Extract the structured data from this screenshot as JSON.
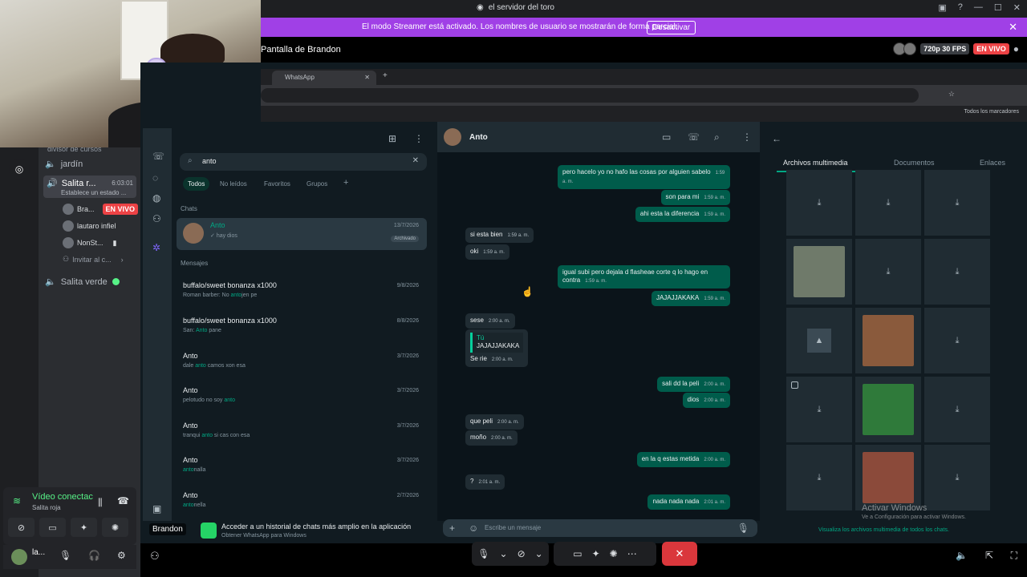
{
  "window": {
    "title": "el servidor del toro"
  },
  "banner": {
    "text": "El modo Streamer está activado. Los nombres de usuario se mostrarán de forma parcial.",
    "button": "Desactivar"
  },
  "stream": {
    "title": "Pantalla de Brandon",
    "quality": "720p 30 FPS",
    "live": "EN VIVO"
  },
  "sidebar": {
    "category": "divisor de cursos",
    "channels": [
      {
        "name": "jardín"
      },
      {
        "name": "Salita r...",
        "time": "6:03:01",
        "status": "Establece un estado ..."
      },
      {
        "name": "Salita verde"
      }
    ],
    "users": [
      {
        "name": "Bra...",
        "badge": "EN VIVO"
      },
      {
        "name": "lautaro infiel"
      },
      {
        "name": "NonSt..."
      }
    ],
    "invite": "Invitar al c...",
    "voice": {
      "status": "Vídeo conectac",
      "sub": "Salita roja"
    },
    "user": {
      "name": "la..."
    }
  },
  "browser": {
    "tab": "WhatsApp",
    "bookmarks": "Todos los marcadores"
  },
  "whatsapp": {
    "search": "anto",
    "filters": [
      "Todos",
      "No leídos",
      "Favoritos",
      "Grupos"
    ],
    "chats_label": "Chats",
    "pinned": {
      "name": "Anto",
      "preview": "hay dios",
      "date": "13/7/2026",
      "tag": "Archivado"
    },
    "messages_label": "Mensajes",
    "rows": [
      {
        "name": "buffalo/sweet bonanza x1000",
        "pre": "Roman barber: No ",
        "hl": "anto",
        "post": "jen pe",
        "date": "9/8/2026"
      },
      {
        "name": "buffalo/sweet bonanza x1000",
        "pre": "San: ",
        "hl": "Anto",
        "post": " pane",
        "date": "8/8/2026"
      },
      {
        "name": "Anto",
        "pre": "dale ",
        "hl": "anto",
        "post": " camos xon esa",
        "date": "3/7/2026"
      },
      {
        "name": "Anto",
        "pre": "pelotudo no soy ",
        "hl": "anto",
        "post": "",
        "date": "3/7/2026"
      },
      {
        "name": "Anto",
        "pre": "tranqui ",
        "hl": "anto",
        "post": " si cas con esa",
        "date": "3/7/2026"
      },
      {
        "name": "Anto",
        "pre": "",
        "hl": "anto",
        "post": "nalla",
        "date": "3/7/2026"
      },
      {
        "name": "Anto",
        "pre": "",
        "hl": "anto",
        "post": "nella",
        "date": "2/7/2026"
      }
    ],
    "banner": {
      "title": "Acceder a un historial de chats más amplio en la aplicación",
      "sub": "Obtener WhatsApp para Windows"
    },
    "conversation": {
      "contact": "Anto",
      "messages": [
        {
          "dir": "out",
          "text": "pero hacelo yo no hafo las cosas por alguien sabelo",
          "time": "1:59 a. m."
        },
        {
          "dir": "out",
          "text": "son para mi",
          "time": "1:59 a. m."
        },
        {
          "dir": "out",
          "text": "ahi esta la diferencia",
          "time": "1:59 a. m."
        },
        {
          "dir": "in",
          "text": "si esta bien",
          "time": "1:59 a. m."
        },
        {
          "dir": "in",
          "text": "oki",
          "time": "1:59 a. m."
        },
        {
          "dir": "out",
          "text": "igual subi pero dejala d flasheae corte q lo hago en contra",
          "time": "1:59 a. m."
        },
        {
          "dir": "out",
          "text": "JAJAJJAKAKA",
          "time": "1:59 a. m."
        },
        {
          "dir": "in",
          "text": "sese",
          "time": "2:00 a. m."
        },
        {
          "dir": "in",
          "quote_author": "Tú",
          "quote": "JAJAJJAKAKA",
          "text": "Se rie",
          "time": "2:00 a. m."
        },
        {
          "dir": "out",
          "text": "sali dd la peli",
          "time": "2:00 a. m."
        },
        {
          "dir": "out",
          "text": "dios",
          "time": "2:00 a. m."
        },
        {
          "dir": "in",
          "text": "que peli",
          "time": "2:00 a. m."
        },
        {
          "dir": "in",
          "text": "moño",
          "time": "2:00 a. m."
        },
        {
          "dir": "out",
          "text": "en la q estas metida",
          "time": "2:00 a. m."
        },
        {
          "dir": "in",
          "text": "?",
          "time": "2:01 a. m."
        },
        {
          "dir": "out",
          "text": "nada nada nada",
          "time": "2:01 a. m."
        }
      ],
      "placeholder": "Escribe un mensaje"
    },
    "media": {
      "tabs": [
        "Archivos multimedia",
        "Documentos",
        "Enlaces"
      ],
      "footer": "Visualiza los archivos multimedia de todos los chats."
    }
  },
  "watermark": {
    "title": "Activar Windows",
    "sub": "Ve a Configuración para activar Windows."
  },
  "screen_tag": "Brandon",
  "colors": {
    "accent": "#00a884",
    "banner": "#a040e6",
    "live": "#ed4245",
    "hangup": "#da373c"
  }
}
